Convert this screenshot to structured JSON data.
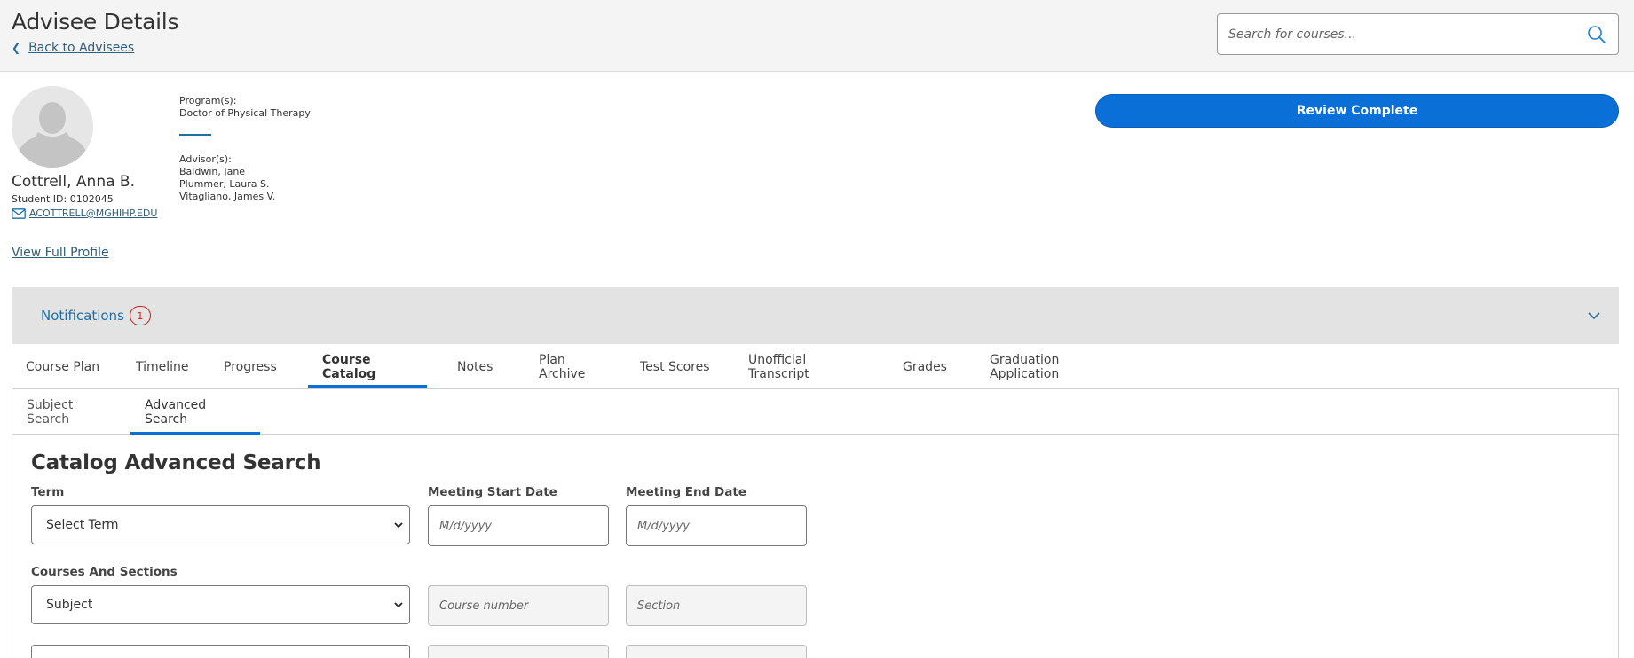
{
  "header": {
    "title": "Advisee Details",
    "back_label": "Back to Advisees",
    "search_placeholder": "Search for courses..."
  },
  "student": {
    "name": "Cottrell, Anna B.",
    "id_text": "Student ID: 0102045",
    "email": "ACOTTRELL@MGHIHP.EDU",
    "view_profile": "View Full Profile",
    "programs_label": "Program(s):",
    "program": "Doctor of Physical Therapy",
    "advisors_label": "Advisor(s):",
    "advisors": [
      "Baldwin, Jane",
      "Plummer, Laura S.",
      "Vitagliano, James V."
    ]
  },
  "review_button": "Review Complete",
  "notifications": {
    "label": "Notifications",
    "count": "1"
  },
  "main_tabs": [
    "Course Plan",
    "Timeline",
    "Progress",
    "Course Catalog",
    "Notes",
    "Plan Archive",
    "Test Scores",
    "Unofficial Transcript",
    "Grades",
    "Graduation Application"
  ],
  "sub_tabs": [
    "Subject Search",
    "Advanced Search"
  ],
  "search_form": {
    "title": "Catalog Advanced Search",
    "term_label": "Term",
    "term_value": "Select Term",
    "start_label": "Meeting Start Date",
    "start_placeholder": "M/d/yyyy",
    "end_label": "Meeting End Date",
    "end_placeholder": "M/d/yyyy",
    "courses_label": "Courses And Sections",
    "subject_value": "Subject",
    "course_placeholder": "Course number",
    "section_placeholder": "Section"
  },
  "colors": {
    "primary": "#0a6fd6",
    "link": "#2f5f7a",
    "badge": "#c41e1e"
  }
}
